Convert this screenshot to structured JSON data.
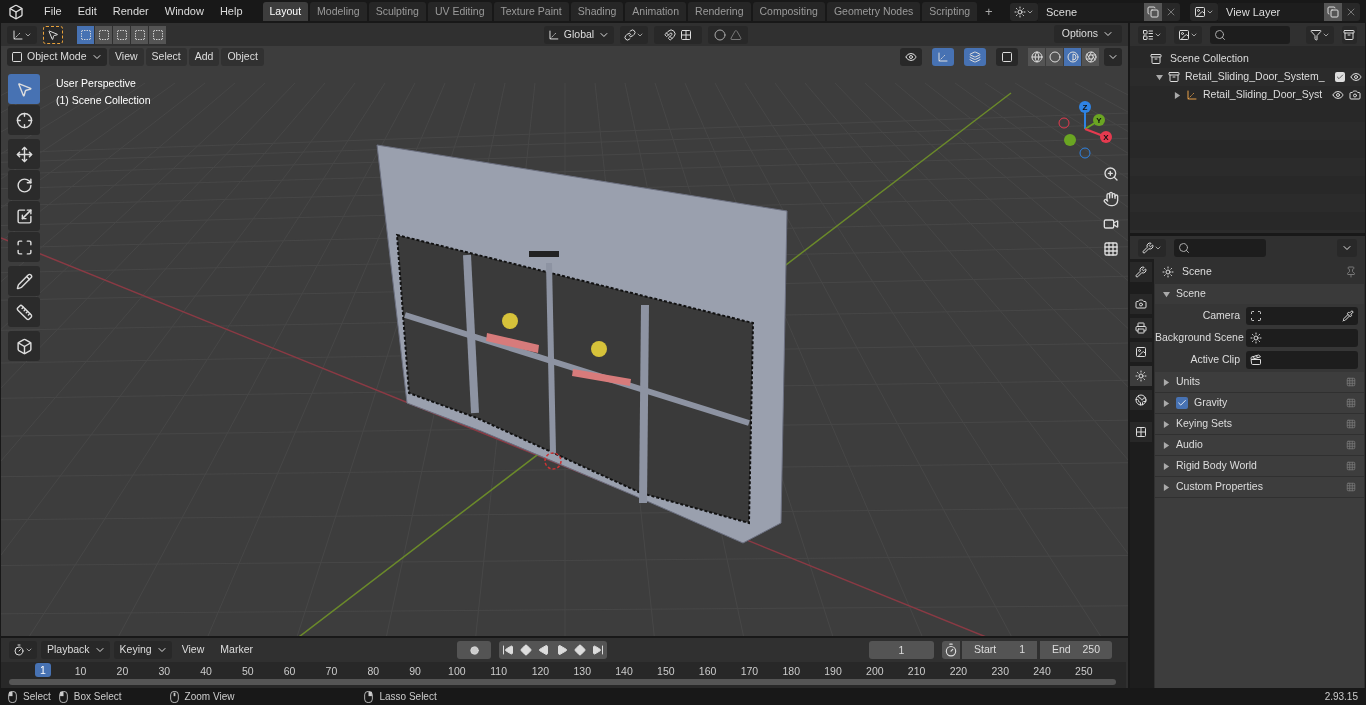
{
  "menu": [
    "File",
    "Edit",
    "Render",
    "Window",
    "Help"
  ],
  "workspaces": [
    {
      "label": "Layout",
      "selected": true
    },
    {
      "label": "Modeling",
      "selected": false
    },
    {
      "label": "Sculpting",
      "selected": false
    },
    {
      "label": "UV Editing",
      "selected": false
    },
    {
      "label": "Texture Paint",
      "selected": false
    },
    {
      "label": "Shading",
      "selected": false
    },
    {
      "label": "Animation",
      "selected": false
    },
    {
      "label": "Rendering",
      "selected": false
    },
    {
      "label": "Compositing",
      "selected": false
    },
    {
      "label": "Geometry Nodes",
      "selected": false
    },
    {
      "label": "Scripting",
      "selected": false
    }
  ],
  "add_workspace": "+",
  "scene": {
    "value": "Scene"
  },
  "view_layer": {
    "value": "View Layer"
  },
  "viewport": {
    "select_modes": [
      {
        "selected": true
      },
      {
        "selected": false
      },
      {
        "selected": false
      },
      {
        "selected": false
      },
      {
        "selected": false
      }
    ],
    "mode": "Object Mode",
    "menus": [
      "View",
      "Select",
      "Add",
      "Object"
    ],
    "orientation": "Global",
    "options": "Options",
    "snap": {
      "on": false
    },
    "proportional": {
      "on": false
    },
    "overlay_text": [
      "User Perspective",
      "(1) Scene Collection"
    ],
    "toggles": [
      {
        "kind": "visibility",
        "on": false
      },
      {
        "kind": "gizmo",
        "on": true
      },
      {
        "kind": "overlay",
        "on": true
      },
      {
        "kind": "xray",
        "on": false
      }
    ],
    "shading": [
      {
        "kind": "wireframe",
        "selected": false
      },
      {
        "kind": "solid",
        "selected": false
      },
      {
        "kind": "material",
        "selected": true
      },
      {
        "kind": "rendered",
        "selected": false
      }
    ],
    "tools": [
      {
        "kind": "select",
        "selected": true
      },
      {
        "kind": "cursor",
        "selected": false
      },
      {
        "kind": "move",
        "selected": false
      },
      {
        "kind": "rotate",
        "selected": false
      },
      {
        "kind": "scale",
        "selected": false
      },
      {
        "kind": "transform",
        "selected": false
      },
      {
        "kind": "annotate",
        "selected": false
      },
      {
        "kind": "measure",
        "selected": false
      },
      {
        "kind": "add",
        "selected": false
      }
    ],
    "gizmo_labels": [
      "X",
      "Y",
      "Z"
    ]
  },
  "outliner": {
    "root": "Scene Collection",
    "items": [
      {
        "label": "Retail_Sliding_Door_System_",
        "expanded": true,
        "checked": true,
        "children": [
          {
            "label": "Retail_Sliding_Door_Syst",
            "expanded": false
          }
        ]
      }
    ]
  },
  "properties": {
    "tabs": [
      {
        "kind": "tool",
        "selected": false
      },
      {
        "kind": "render",
        "selected": false
      },
      {
        "kind": "output",
        "selected": false
      },
      {
        "kind": "view_layer",
        "selected": false
      },
      {
        "kind": "scene",
        "selected": true
      },
      {
        "kind": "world",
        "selected": false
      },
      {
        "kind": "texture",
        "selected": false
      }
    ],
    "context": "Scene",
    "section": {
      "title": "Scene",
      "expanded": true
    },
    "fields": [
      {
        "label": "Camera",
        "kind": "camera"
      },
      {
        "label": "Background Scene",
        "kind": "scene"
      },
      {
        "label": "Active Clip",
        "kind": "clip"
      }
    ],
    "panels": [
      {
        "label": "Units",
        "kind": "plain",
        "expanded": false
      },
      {
        "label": "Gravity",
        "kind": "checkbox",
        "checked": true,
        "expanded": false
      },
      {
        "label": "Keying Sets",
        "kind": "plain",
        "expanded": false
      },
      {
        "label": "Audio",
        "kind": "plain",
        "expanded": false
      },
      {
        "label": "Rigid Body World",
        "kind": "plain",
        "expanded": false
      },
      {
        "label": "Custom Properties",
        "kind": "plain",
        "expanded": false
      }
    ]
  },
  "timeline": {
    "menus": [
      "Playback",
      "Keying",
      "View",
      "Marker"
    ],
    "auto_keying": {
      "on": false
    },
    "current_frame": "1",
    "start_label": "Start",
    "start": "1",
    "end_label": "End",
    "end": "250",
    "playhead": "1",
    "ticks": [
      "10",
      "20",
      "30",
      "40",
      "50",
      "60",
      "70",
      "80",
      "90",
      "100",
      "110",
      "120",
      "130",
      "140",
      "150",
      "160",
      "170",
      "180",
      "190",
      "200",
      "210",
      "220",
      "230",
      "240",
      "250"
    ]
  },
  "status": {
    "hints": [
      {
        "kind": "left",
        "label": "Select"
      },
      {
        "kind": "left",
        "label": "Box Select"
      },
      {
        "kind": "middle",
        "label": "Zoom View"
      },
      {
        "kind": "right",
        "label": "Lasso Select"
      }
    ],
    "version": "2.93.15"
  }
}
